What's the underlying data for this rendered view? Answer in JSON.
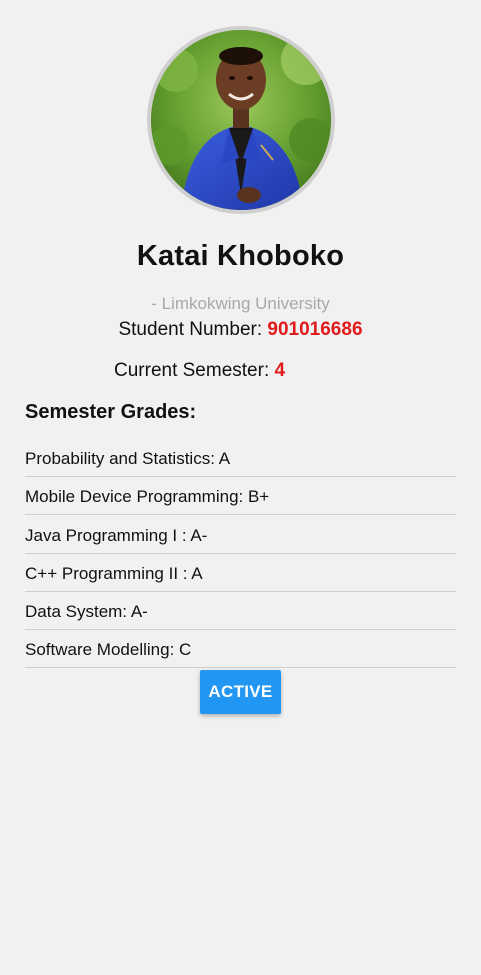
{
  "profile": {
    "name": "Katai Khoboko",
    "university": "- Limkokwing University",
    "student_number_label": "Student Number: ",
    "student_number_value": "901016686",
    "current_semester_label": "Current Semester: ",
    "current_semester_value": "4"
  },
  "grades": {
    "heading": "Semester Grades:",
    "items": [
      "Probability and Statistics: A",
      "Mobile Device Programming: B+",
      "Java Programming I : A-",
      "C++ Programming II : A",
      "Data System: A-",
      "Software Modelling: C"
    ]
  },
  "actions": {
    "status_button_label": "ACTIVE"
  },
  "colors": {
    "background": "#f1f1f1",
    "accent_blue": "#2196f3",
    "highlight_red": "#e01b1b",
    "divider": "#cfcfcf",
    "muted_text": "#a9a9a9"
  }
}
